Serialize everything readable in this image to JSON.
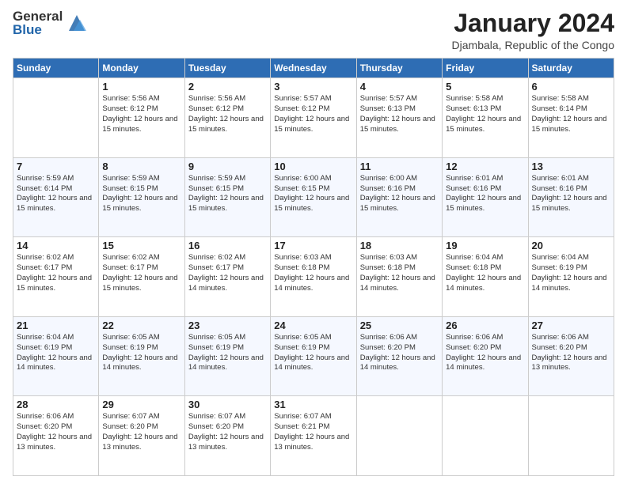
{
  "logo": {
    "general": "General",
    "blue": "Blue"
  },
  "header": {
    "month": "January 2024",
    "location": "Djambala, Republic of the Congo"
  },
  "weekdays": [
    "Sunday",
    "Monday",
    "Tuesday",
    "Wednesday",
    "Thursday",
    "Friday",
    "Saturday"
  ],
  "weeks": [
    [
      {
        "day": "",
        "sunrise": "",
        "sunset": "",
        "daylight": ""
      },
      {
        "day": "1",
        "sunrise": "Sunrise: 5:56 AM",
        "sunset": "Sunset: 6:12 PM",
        "daylight": "Daylight: 12 hours and 15 minutes."
      },
      {
        "day": "2",
        "sunrise": "Sunrise: 5:56 AM",
        "sunset": "Sunset: 6:12 PM",
        "daylight": "Daylight: 12 hours and 15 minutes."
      },
      {
        "day": "3",
        "sunrise": "Sunrise: 5:57 AM",
        "sunset": "Sunset: 6:12 PM",
        "daylight": "Daylight: 12 hours and 15 minutes."
      },
      {
        "day": "4",
        "sunrise": "Sunrise: 5:57 AM",
        "sunset": "Sunset: 6:13 PM",
        "daylight": "Daylight: 12 hours and 15 minutes."
      },
      {
        "day": "5",
        "sunrise": "Sunrise: 5:58 AM",
        "sunset": "Sunset: 6:13 PM",
        "daylight": "Daylight: 12 hours and 15 minutes."
      },
      {
        "day": "6",
        "sunrise": "Sunrise: 5:58 AM",
        "sunset": "Sunset: 6:14 PM",
        "daylight": "Daylight: 12 hours and 15 minutes."
      }
    ],
    [
      {
        "day": "7",
        "sunrise": "Sunrise: 5:59 AM",
        "sunset": "Sunset: 6:14 PM",
        "daylight": "Daylight: 12 hours and 15 minutes."
      },
      {
        "day": "8",
        "sunrise": "Sunrise: 5:59 AM",
        "sunset": "Sunset: 6:15 PM",
        "daylight": "Daylight: 12 hours and 15 minutes."
      },
      {
        "day": "9",
        "sunrise": "Sunrise: 5:59 AM",
        "sunset": "Sunset: 6:15 PM",
        "daylight": "Daylight: 12 hours and 15 minutes."
      },
      {
        "day": "10",
        "sunrise": "Sunrise: 6:00 AM",
        "sunset": "Sunset: 6:15 PM",
        "daylight": "Daylight: 12 hours and 15 minutes."
      },
      {
        "day": "11",
        "sunrise": "Sunrise: 6:00 AM",
        "sunset": "Sunset: 6:16 PM",
        "daylight": "Daylight: 12 hours and 15 minutes."
      },
      {
        "day": "12",
        "sunrise": "Sunrise: 6:01 AM",
        "sunset": "Sunset: 6:16 PM",
        "daylight": "Daylight: 12 hours and 15 minutes."
      },
      {
        "day": "13",
        "sunrise": "Sunrise: 6:01 AM",
        "sunset": "Sunset: 6:16 PM",
        "daylight": "Daylight: 12 hours and 15 minutes."
      }
    ],
    [
      {
        "day": "14",
        "sunrise": "Sunrise: 6:02 AM",
        "sunset": "Sunset: 6:17 PM",
        "daylight": "Daylight: 12 hours and 15 minutes."
      },
      {
        "day": "15",
        "sunrise": "Sunrise: 6:02 AM",
        "sunset": "Sunset: 6:17 PM",
        "daylight": "Daylight: 12 hours and 15 minutes."
      },
      {
        "day": "16",
        "sunrise": "Sunrise: 6:02 AM",
        "sunset": "Sunset: 6:17 PM",
        "daylight": "Daylight: 12 hours and 14 minutes."
      },
      {
        "day": "17",
        "sunrise": "Sunrise: 6:03 AM",
        "sunset": "Sunset: 6:18 PM",
        "daylight": "Daylight: 12 hours and 14 minutes."
      },
      {
        "day": "18",
        "sunrise": "Sunrise: 6:03 AM",
        "sunset": "Sunset: 6:18 PM",
        "daylight": "Daylight: 12 hours and 14 minutes."
      },
      {
        "day": "19",
        "sunrise": "Sunrise: 6:04 AM",
        "sunset": "Sunset: 6:18 PM",
        "daylight": "Daylight: 12 hours and 14 minutes."
      },
      {
        "day": "20",
        "sunrise": "Sunrise: 6:04 AM",
        "sunset": "Sunset: 6:19 PM",
        "daylight": "Daylight: 12 hours and 14 minutes."
      }
    ],
    [
      {
        "day": "21",
        "sunrise": "Sunrise: 6:04 AM",
        "sunset": "Sunset: 6:19 PM",
        "daylight": "Daylight: 12 hours and 14 minutes."
      },
      {
        "day": "22",
        "sunrise": "Sunrise: 6:05 AM",
        "sunset": "Sunset: 6:19 PM",
        "daylight": "Daylight: 12 hours and 14 minutes."
      },
      {
        "day": "23",
        "sunrise": "Sunrise: 6:05 AM",
        "sunset": "Sunset: 6:19 PM",
        "daylight": "Daylight: 12 hours and 14 minutes."
      },
      {
        "day": "24",
        "sunrise": "Sunrise: 6:05 AM",
        "sunset": "Sunset: 6:19 PM",
        "daylight": "Daylight: 12 hours and 14 minutes."
      },
      {
        "day": "25",
        "sunrise": "Sunrise: 6:06 AM",
        "sunset": "Sunset: 6:20 PM",
        "daylight": "Daylight: 12 hours and 14 minutes."
      },
      {
        "day": "26",
        "sunrise": "Sunrise: 6:06 AM",
        "sunset": "Sunset: 6:20 PM",
        "daylight": "Daylight: 12 hours and 14 minutes."
      },
      {
        "day": "27",
        "sunrise": "Sunrise: 6:06 AM",
        "sunset": "Sunset: 6:20 PM",
        "daylight": "Daylight: 12 hours and 13 minutes."
      }
    ],
    [
      {
        "day": "28",
        "sunrise": "Sunrise: 6:06 AM",
        "sunset": "Sunset: 6:20 PM",
        "daylight": "Daylight: 12 hours and 13 minutes."
      },
      {
        "day": "29",
        "sunrise": "Sunrise: 6:07 AM",
        "sunset": "Sunset: 6:20 PM",
        "daylight": "Daylight: 12 hours and 13 minutes."
      },
      {
        "day": "30",
        "sunrise": "Sunrise: 6:07 AM",
        "sunset": "Sunset: 6:20 PM",
        "daylight": "Daylight: 12 hours and 13 minutes."
      },
      {
        "day": "31",
        "sunrise": "Sunrise: 6:07 AM",
        "sunset": "Sunset: 6:21 PM",
        "daylight": "Daylight: 12 hours and 13 minutes."
      },
      {
        "day": "",
        "sunrise": "",
        "sunset": "",
        "daylight": ""
      },
      {
        "day": "",
        "sunrise": "",
        "sunset": "",
        "daylight": ""
      },
      {
        "day": "",
        "sunrise": "",
        "sunset": "",
        "daylight": ""
      }
    ]
  ]
}
